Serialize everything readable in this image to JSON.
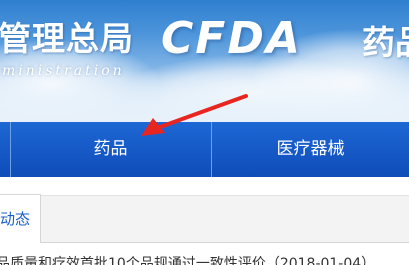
{
  "banner": {
    "agency_title": "管理总局",
    "agency_subtitle": "ministration",
    "logo_text": "CFDA",
    "right_title": "药品"
  },
  "nav": {
    "items": [
      {
        "label": ""
      },
      {
        "label": "药品"
      },
      {
        "label": "医疗器械"
      }
    ],
    "background_color": "#1558c6"
  },
  "tabs": {
    "active_label": "动态"
  },
  "news": {
    "first_item": "品质量和疗效首批10个品规通过一致性评价（2018-01-04）"
  },
  "annotation": {
    "arrow_color": "#e8251f"
  }
}
